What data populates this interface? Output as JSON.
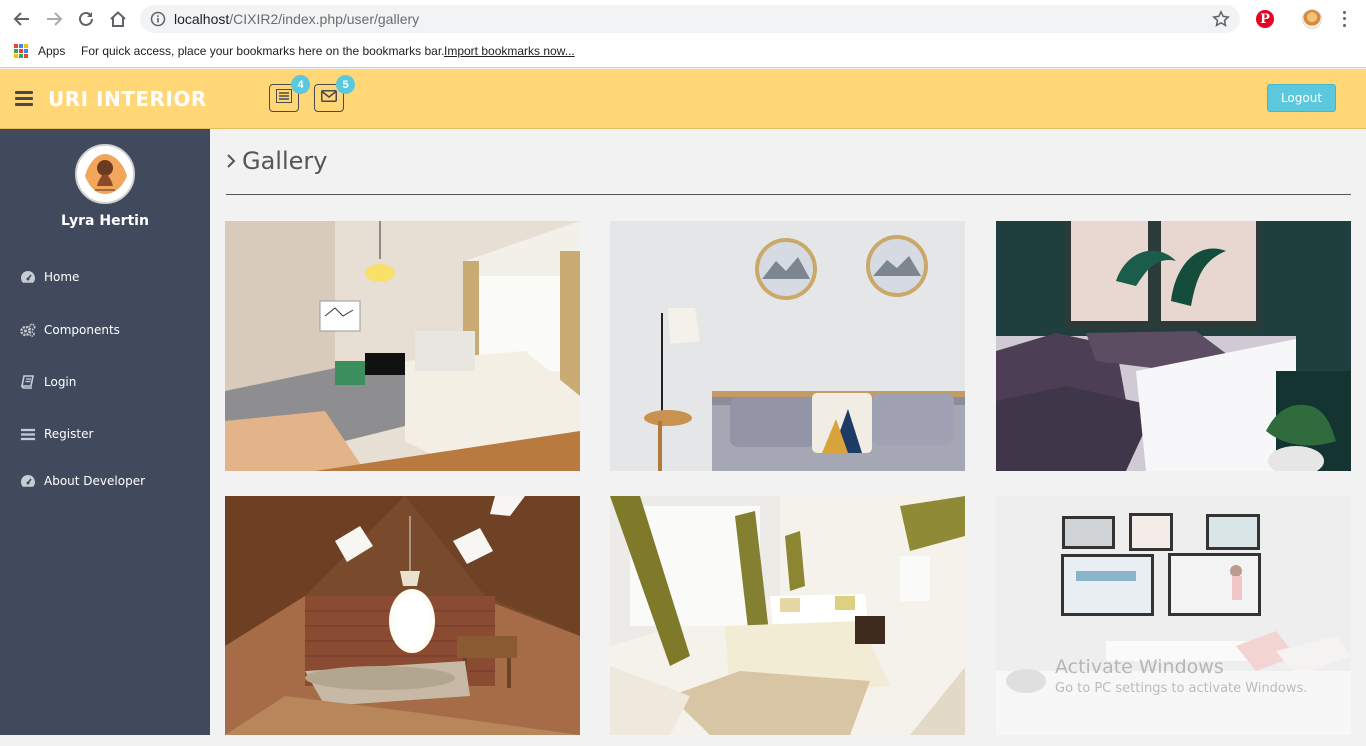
{
  "browser": {
    "url_host": "localhost",
    "url_path": "/CIXIR2/index.php/user/gallery",
    "bookmarks": {
      "apps_label": "Apps",
      "hint": "For quick access, place your bookmarks here on the bookmarks bar.",
      "import_link": "Import bookmarks now..."
    },
    "extension_pinterest_glyph": "P"
  },
  "header": {
    "brand": "URI INTERIOR",
    "tasks_badge": "4",
    "messages_badge": "5",
    "logout_label": "Logout",
    "color": "#ffd777",
    "badge_color": "#5bc8de"
  },
  "sidebar": {
    "profile_name": "Lyra Hertin",
    "items": [
      {
        "label": "Home",
        "icon": "dashboard-icon"
      },
      {
        "label": "Components",
        "icon": "cogs-icon"
      },
      {
        "label": "Login",
        "icon": "book-icon"
      },
      {
        "label": "Register",
        "icon": "list-icon"
      },
      {
        "label": "About Developer",
        "icon": "dashboard-icon"
      }
    ],
    "color": "#414a5c"
  },
  "main": {
    "title": "Gallery",
    "gallery": [
      {
        "name": "bedroom-window-pendant-lamp"
      },
      {
        "name": "sofa-round-mountain-art"
      },
      {
        "name": "dark-green-bedroom-plants"
      },
      {
        "name": "attic-bedroom-brick-wall"
      },
      {
        "name": "bright-bedroom-olive-curtains"
      },
      {
        "name": "white-room-framed-prints"
      }
    ]
  },
  "watermark": {
    "line1": "Activate Windows",
    "line2": "Go to PC settings to activate Windows."
  }
}
